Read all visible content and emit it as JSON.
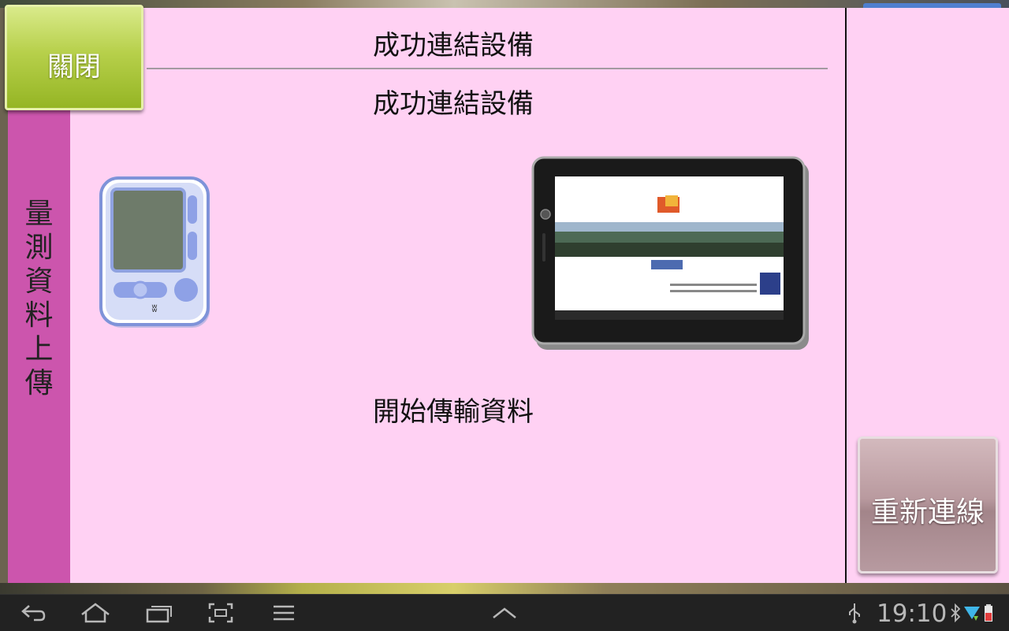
{
  "dialog": {
    "close_label": "關閉",
    "title": "成功連結設備",
    "message": "成功連結設備",
    "status": "開始傳輸資料",
    "side_label_chars": [
      "量",
      "測",
      "資",
      "料",
      "上",
      "傳"
    ],
    "reconnect_label": "重新連線"
  },
  "colors": {
    "dialog_bg": "#ffd1f3",
    "side_panel": "#cc55ad",
    "close_button": "#b7d04b",
    "reconnect_button": "#b99a9f",
    "navbar": "#222222"
  },
  "icons": {
    "left_device": "blood-pressure-monitor-icon",
    "right_device": "tablet-icon"
  },
  "navbar": {
    "buttons": [
      "back-icon",
      "home-icon",
      "recent-apps-icon",
      "screenshot-icon",
      "menu-icon",
      "up-chevron-icon"
    ],
    "clock": "19:10",
    "status_icons": [
      "usb-icon",
      "bluetooth-icon",
      "wifi-icon",
      "battery-icon"
    ]
  }
}
